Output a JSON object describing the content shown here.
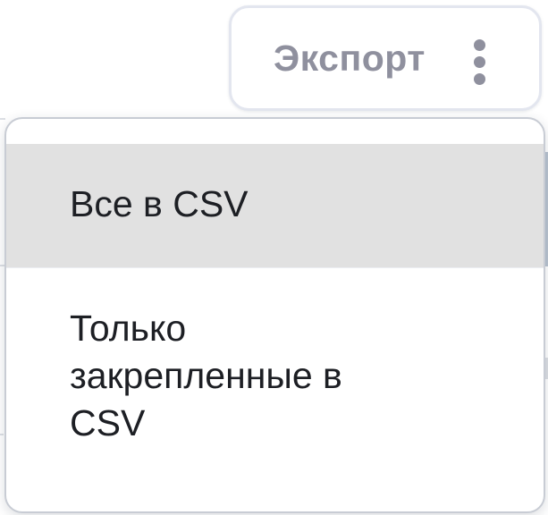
{
  "export_button": {
    "label": "Экспорт",
    "icon": "kebab-vertical-icon"
  },
  "export_menu": {
    "items": [
      {
        "label": "Все в CSV",
        "highlighted": true
      },
      {
        "label": "Только закрепленные в CSV",
        "highlighted": false
      }
    ]
  },
  "colors": {
    "button_text": "#8f909e",
    "menu_text": "#1d1f24",
    "highlight_bg": "#e1e1e1",
    "border": "#c8ccd4"
  }
}
